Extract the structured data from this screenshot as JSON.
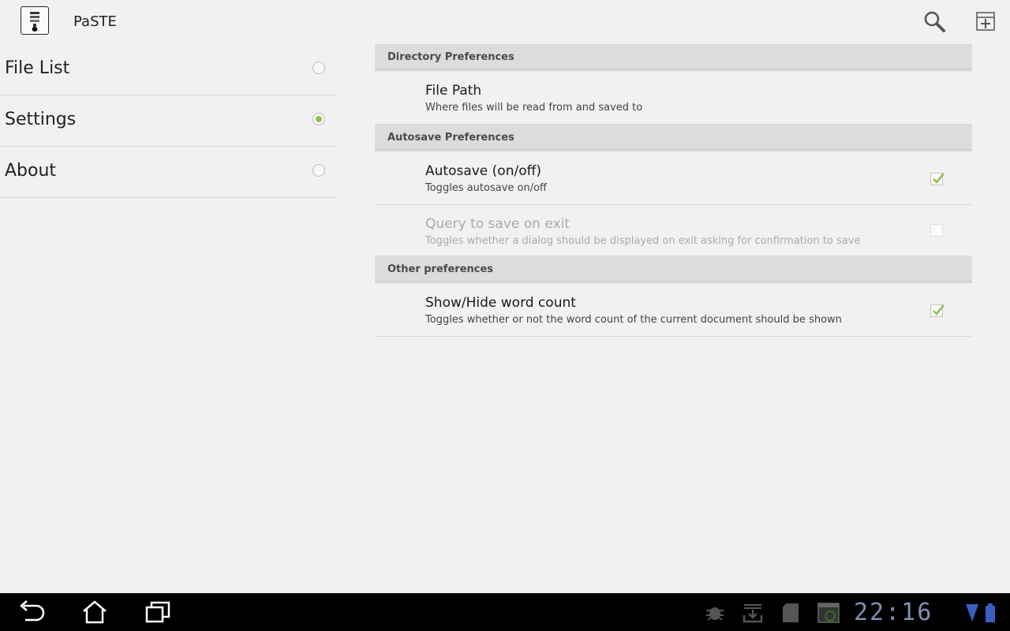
{
  "app": {
    "title": "PaSTE"
  },
  "nav": {
    "items": [
      {
        "label": "File List",
        "selected": false
      },
      {
        "label": "Settings",
        "selected": true
      },
      {
        "label": "About",
        "selected": false
      }
    ]
  },
  "prefs": {
    "directory": {
      "header": "Directory Preferences",
      "file_path": {
        "title": "File Path",
        "summary": "Where files will be read from and saved to"
      }
    },
    "autosave": {
      "header": "Autosave Preferences",
      "autosave": {
        "title": "Autosave (on/off)",
        "summary": "Toggles autosave on/off",
        "checked": true
      },
      "query_on_exit": {
        "title": "Query to save on exit",
        "summary": "Toggles whether a dialog should be displayed on exit asking for confirmation to save",
        "checked": false,
        "enabled": false
      }
    },
    "other": {
      "header": "Other preferences",
      "word_count": {
        "title": "Show/Hide word count",
        "summary": "Toggles whether or not the word count of the current document should be shown",
        "checked": true
      }
    }
  },
  "system_bar": {
    "clock": "22:16",
    "icons": [
      "debug-icon",
      "download-icon",
      "sd-card-icon",
      "screenshot-icon",
      "wifi-icon",
      "battery-icon"
    ]
  },
  "colors": {
    "accent": "#8bc34a",
    "clock": "#7e8fb0"
  }
}
